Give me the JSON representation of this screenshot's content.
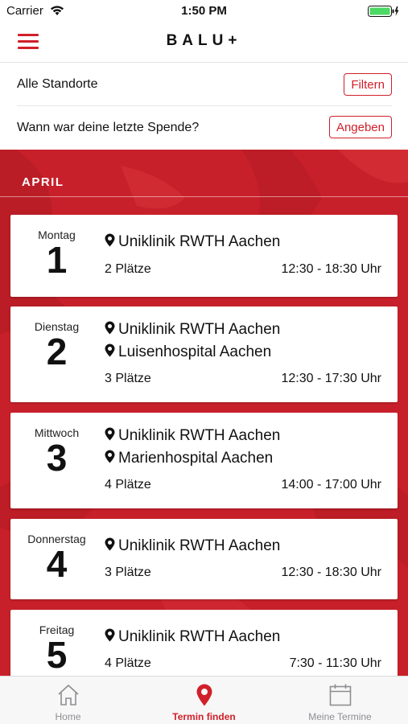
{
  "status": {
    "carrier": "Carrier",
    "time": "1:50 PM"
  },
  "header": {
    "logo": "BALU+"
  },
  "filters": {
    "location_label": "Alle Standorte",
    "filter_button": "Filtern",
    "last_donation_label": "Wann war deine letzte Spende?",
    "specify_button": "Angeben"
  },
  "month": "APRIL",
  "appointments": [
    {
      "weekday": "Montag",
      "day": "1",
      "locations": [
        "Uniklinik RWTH Aachen"
      ],
      "places": "2 Plätze",
      "time": "12:30 - 18:30 Uhr"
    },
    {
      "weekday": "Dienstag",
      "day": "2",
      "locations": [
        "Uniklinik RWTH Aachen",
        "Luisenhospital Aachen"
      ],
      "places": "3 Plätze",
      "time": "12:30 - 17:30 Uhr"
    },
    {
      "weekday": "Mittwoch",
      "day": "3",
      "locations": [
        "Uniklinik RWTH Aachen",
        "Marienhospital Aachen"
      ],
      "places": "4 Plätze",
      "time": "14:00 - 17:00 Uhr"
    },
    {
      "weekday": "Donnerstag",
      "day": "4",
      "locations": [
        "Uniklinik RWTH Aachen"
      ],
      "places": "3 Plätze",
      "time": "12:30 - 18:30 Uhr"
    },
    {
      "weekday": "Freitag",
      "day": "5",
      "locations": [
        "Uniklinik RWTH Aachen"
      ],
      "places": "4 Plätze",
      "time": "7:30 - 11:30 Uhr"
    }
  ],
  "tabs": [
    {
      "label": "Home",
      "icon": "home-icon",
      "active": false
    },
    {
      "label": "Termin finden",
      "icon": "map-pin-icon",
      "active": true
    },
    {
      "label": "Meine Termine",
      "icon": "calendar-icon",
      "active": false
    }
  ],
  "colors": {
    "accent": "#d0202a",
    "background_red": "#c8202a",
    "inactive": "#8e8e93"
  }
}
